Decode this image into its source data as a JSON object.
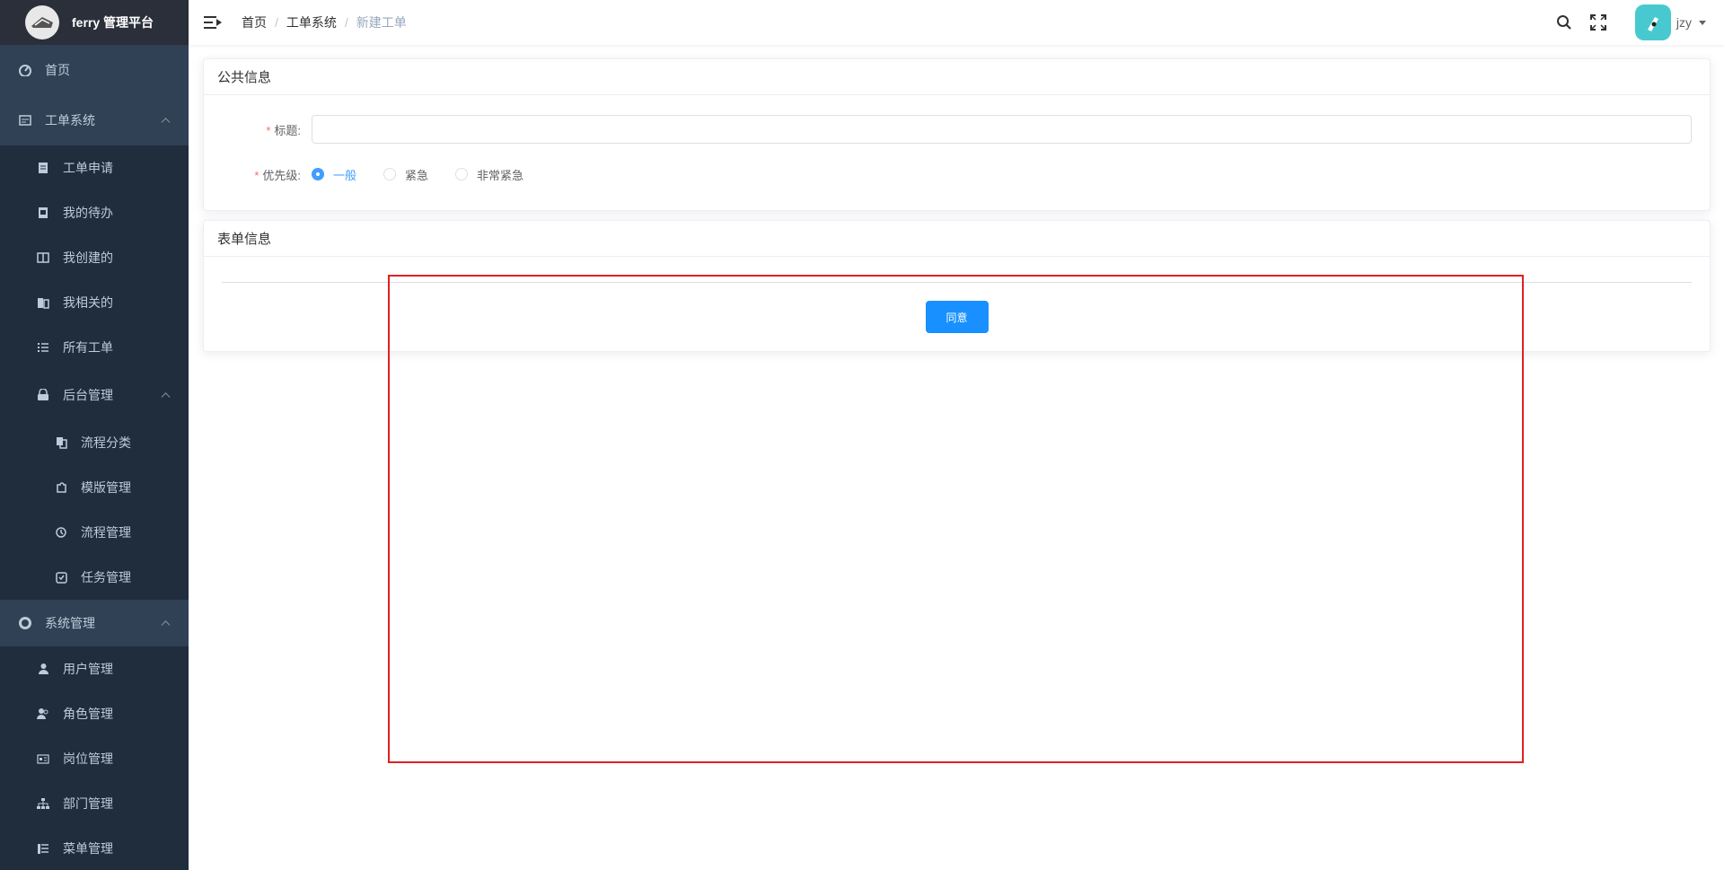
{
  "app": {
    "title": "ferry 管理平台"
  },
  "sidebar": {
    "items": [
      {
        "label": "首页",
        "icon": "dashboard-icon"
      },
      {
        "label": "工单系统",
        "icon": "workorder-icon"
      },
      {
        "label": "工单申请",
        "icon": "form-icon"
      },
      {
        "label": "我的待办",
        "icon": "todo-icon"
      },
      {
        "label": "我创建的",
        "icon": "book-icon"
      },
      {
        "label": "我相关的",
        "icon": "related-icon"
      },
      {
        "label": "所有工单",
        "icon": "list-icon"
      },
      {
        "label": "后台管理",
        "icon": "lock-icon"
      },
      {
        "label": "流程分类",
        "icon": "copy-icon"
      },
      {
        "label": "模版管理",
        "icon": "puzzle-icon"
      },
      {
        "label": "流程管理",
        "icon": "flow-icon"
      },
      {
        "label": "任务管理",
        "icon": "task-icon"
      },
      {
        "label": "系统管理",
        "icon": "settings-icon"
      },
      {
        "label": "用户管理",
        "icon": "user-icon"
      },
      {
        "label": "角色管理",
        "icon": "peoples-icon"
      },
      {
        "label": "岗位管理",
        "icon": "post-icon"
      },
      {
        "label": "部门管理",
        "icon": "tree-icon"
      },
      {
        "label": "菜单管理",
        "icon": "menu-icon"
      }
    ]
  },
  "breadcrumb": [
    "首页",
    "工单系统",
    "新建工单"
  ],
  "user": {
    "name": "jzy"
  },
  "public_info": {
    "title": "公共信息",
    "title_label": "标题:",
    "title_value": "",
    "priority_label": "优先级:",
    "priority_options": [
      "一般",
      "紧急",
      "非常紧急"
    ],
    "priority_selected": "一般"
  },
  "form_info": {
    "title": "表单信息",
    "agree_button": "同意"
  },
  "colors": {
    "sidebar": "#304156",
    "accent": "#1890ff",
    "annotation": "#e02020"
  }
}
